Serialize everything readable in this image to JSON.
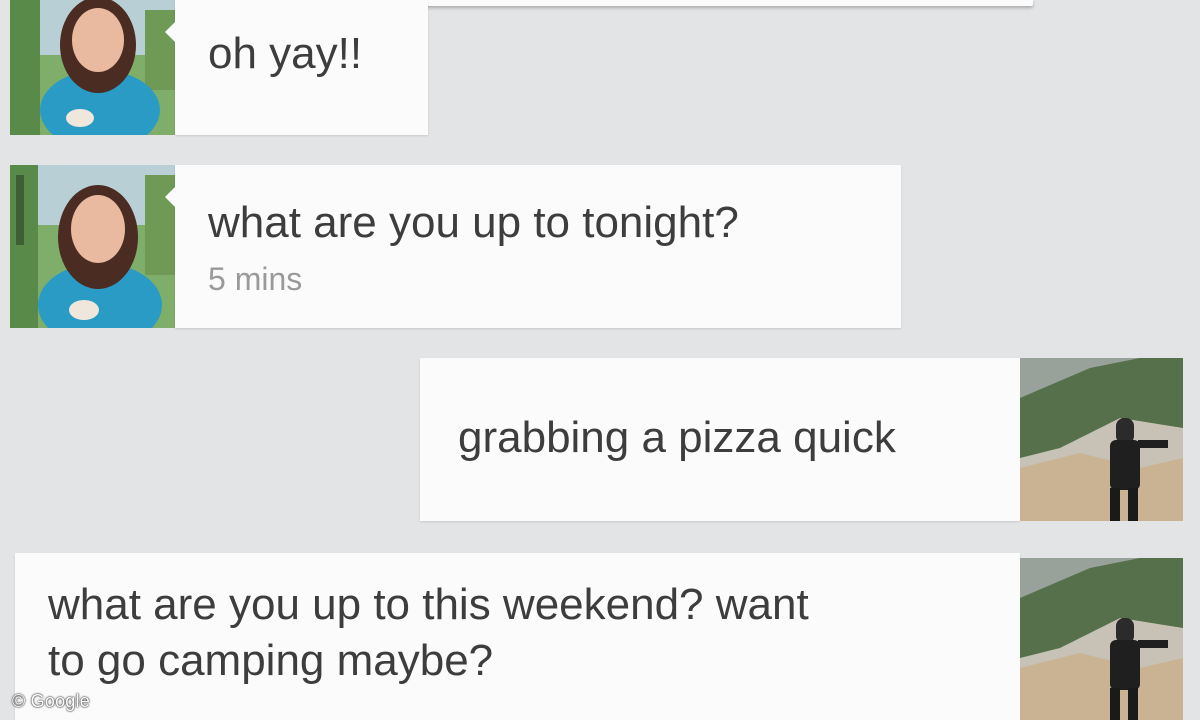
{
  "messages": [
    {
      "sender": "contact",
      "text": "oh yay!!",
      "time": ""
    },
    {
      "sender": "contact",
      "text": "what are you up to tonight?",
      "time": "5 mins"
    },
    {
      "sender": "me",
      "text": "grabbing a pizza quick",
      "time": ""
    },
    {
      "sender": "me",
      "text": "what are you up to this weekend? want\nto go camping maybe?",
      "time": ""
    }
  ],
  "watermark": "© Google",
  "colors": {
    "background": "#e3e4e6",
    "bubble": "#fbfbfb",
    "text": "#3d3d3d",
    "timestamp": "#9a9a9a"
  },
  "icons": {
    "contact_avatar": "woman-photo-avatar",
    "my_avatar": "man-photo-avatar"
  }
}
